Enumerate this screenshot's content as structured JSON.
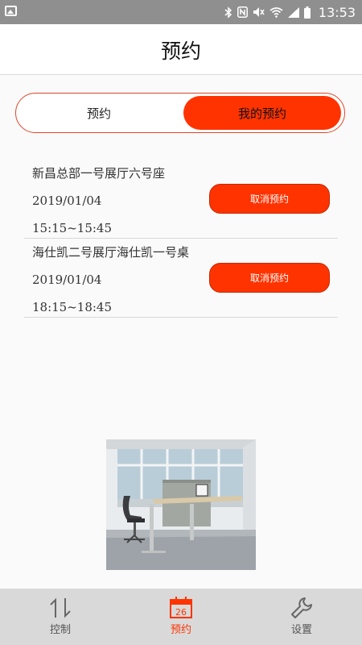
{
  "status_bar": {
    "time": "13:53"
  },
  "header": {
    "title": "预约"
  },
  "segment": {
    "left_label": "预约",
    "right_label": "我的预约",
    "selected": "right"
  },
  "reservations": [
    {
      "room": "新昌总部一号展厅六号座",
      "date": "2019/01/04",
      "time": "15:15~15:45",
      "cancel_label": "取消预约"
    },
    {
      "room": "海仕凯二号展厅海仕凯一号桌",
      "date": "2019/01/04",
      "time": "18:15~18:45",
      "cancel_label": "取消预约"
    }
  ],
  "bottom_nav": {
    "items": [
      {
        "label": "控制",
        "icon": "control-arrows-icon",
        "active": false
      },
      {
        "label": "预约",
        "icon": "calendar-icon",
        "icon_text": "26",
        "active": true
      },
      {
        "label": "设置",
        "icon": "wrench-icon",
        "active": false
      }
    ]
  },
  "colors": {
    "accent": "#ff3300",
    "nav_bg": "#d9d9d9",
    "status_bar": "#8f8f8f"
  }
}
